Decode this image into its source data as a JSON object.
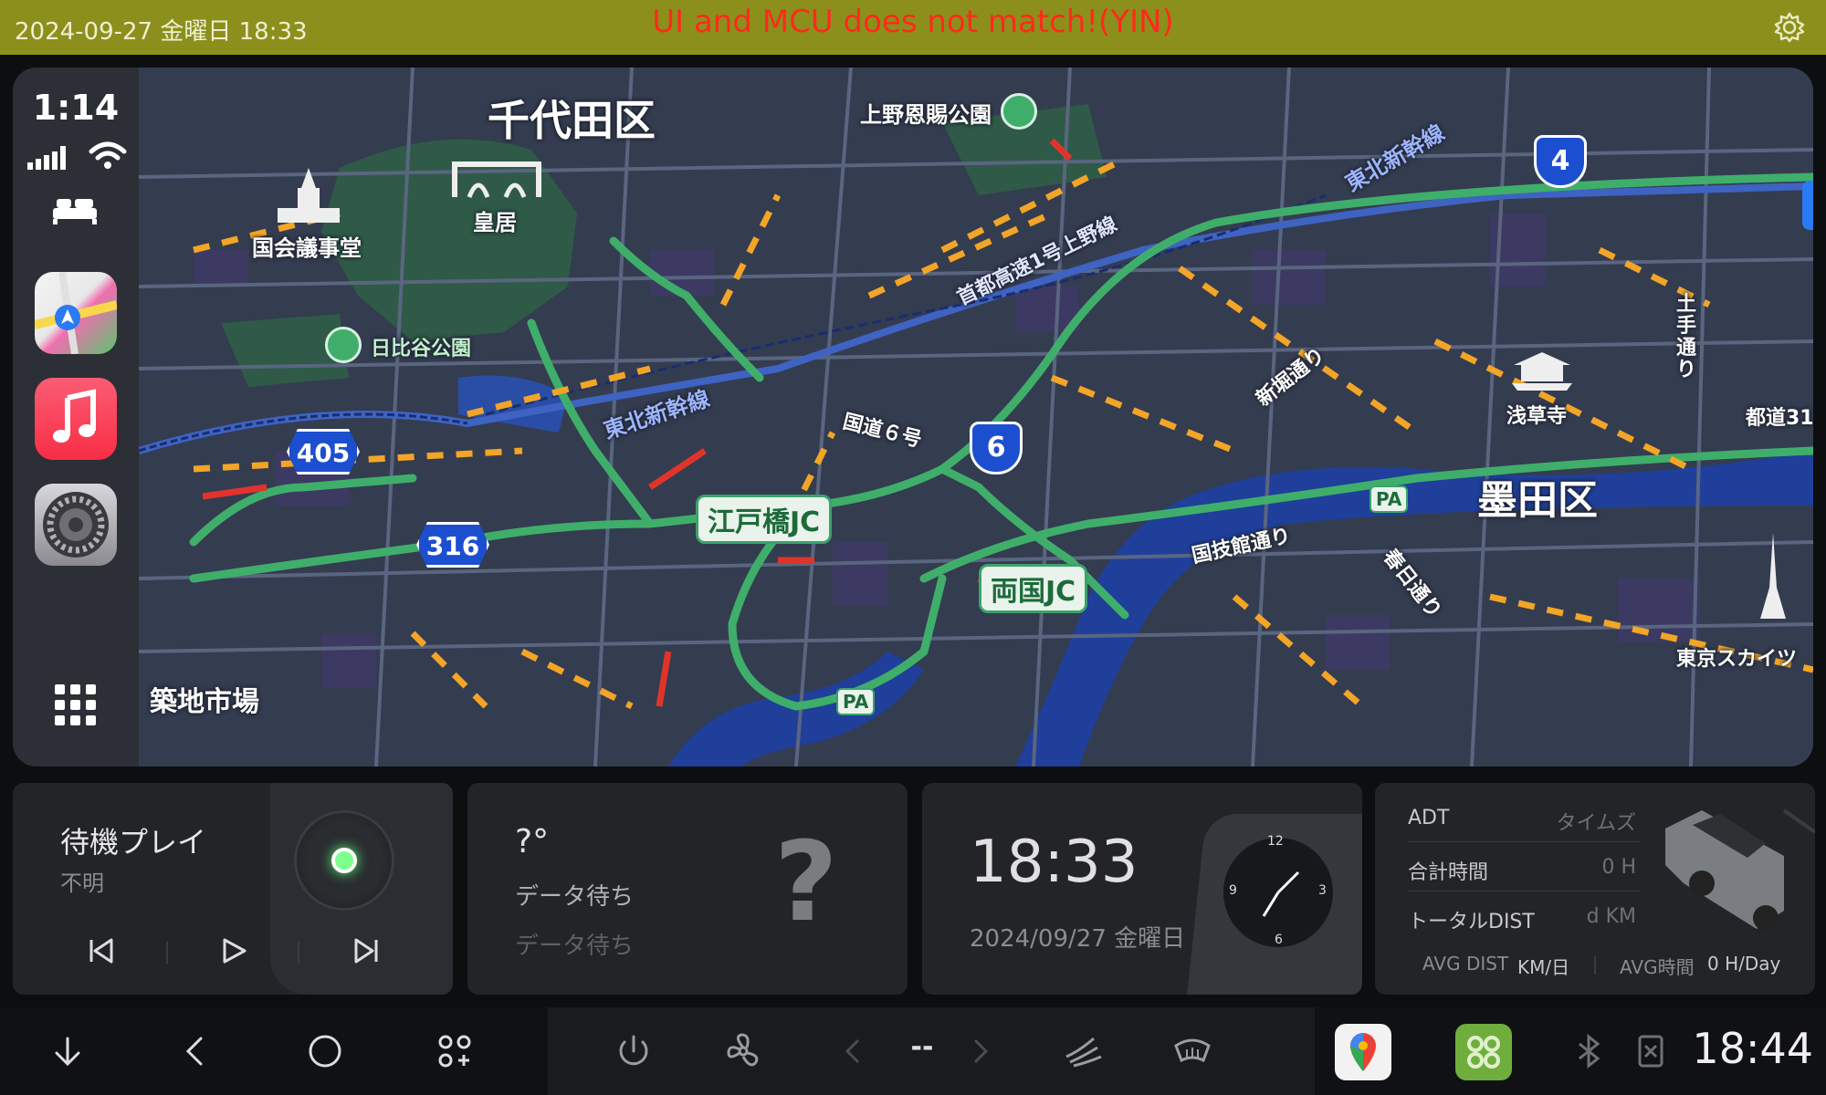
{
  "status_bar": {
    "datetime": "2024-09-27 金曜日 18:33",
    "warning": "UI and MCU does not match!(YIN)",
    "gear_icon": "gear-icon"
  },
  "carplay": {
    "sidebar": {
      "time": "1:14",
      "apps": [
        {
          "name": "maps",
          "icon": "maps-app-icon"
        },
        {
          "name": "music",
          "icon": "music-app-icon"
        },
        {
          "name": "settings",
          "icon": "settings-app-icon"
        }
      ]
    },
    "map": {
      "labels": {
        "chiyoda": "千代田区",
        "ueno_park": "上野恩賜公園",
        "kokkai": "国会議事堂",
        "kokyo": "皇居",
        "hibiya_park": "日比谷公園",
        "shutoko": "首都高速1号上野線",
        "tohoku_shinkansen_1": "東北新幹線",
        "tohoku_shinkansen_2": "東北新幹線",
        "kokudo6": "国道６号",
        "shinbori": "新堀通り",
        "asakusa": "浅草寺",
        "sumida": "墨田区",
        "kokugikan": "国技館通り",
        "kasuga": "春日通り",
        "todo31": "都道31",
        "tsukiji": "築地市場",
        "tokyo_sky": "東京スカイツ",
        "dote": "土手通り",
        "edobashi": "江戸橋JC",
        "ryogoku": "両国JC",
        "pa": "PA"
      },
      "route_shields": [
        "405",
        "316",
        "6",
        "4"
      ]
    }
  },
  "widgets": {
    "media": {
      "title": "待機プレイ",
      "subtitle": "不明"
    },
    "weather": {
      "temp": "?°",
      "line1": "データ待ち",
      "line2": "データ待ち",
      "icon": "?"
    },
    "clock": {
      "time": "18:33",
      "date": "2024/09/27 金曜日",
      "dial_12": "12",
      "dial_3": "3",
      "dial_6": "6",
      "dial_9": "9"
    },
    "trip": {
      "header_left": "ADT",
      "header_right": "タイムズ",
      "rows": [
        {
          "label": "合計時間",
          "value": "0 H"
        },
        {
          "label": "トータルDIST",
          "value": "d KM"
        }
      ],
      "avg_dist_label": "AVG DIST",
      "avg_dist_value": "KM/日",
      "avg_time_label": "AVG時間",
      "avg_time_value": "0 H/Day"
    }
  },
  "navbar": {
    "center_value": "--",
    "clock": "18:44"
  },
  "colors": {
    "status_bg": "#8c8f1c",
    "warning": "#ff2a1a",
    "traffic_green": "#3fae6a",
    "traffic_orange": "#f2a526",
    "traffic_red": "#e0342b",
    "water": "#1f3f9a"
  }
}
